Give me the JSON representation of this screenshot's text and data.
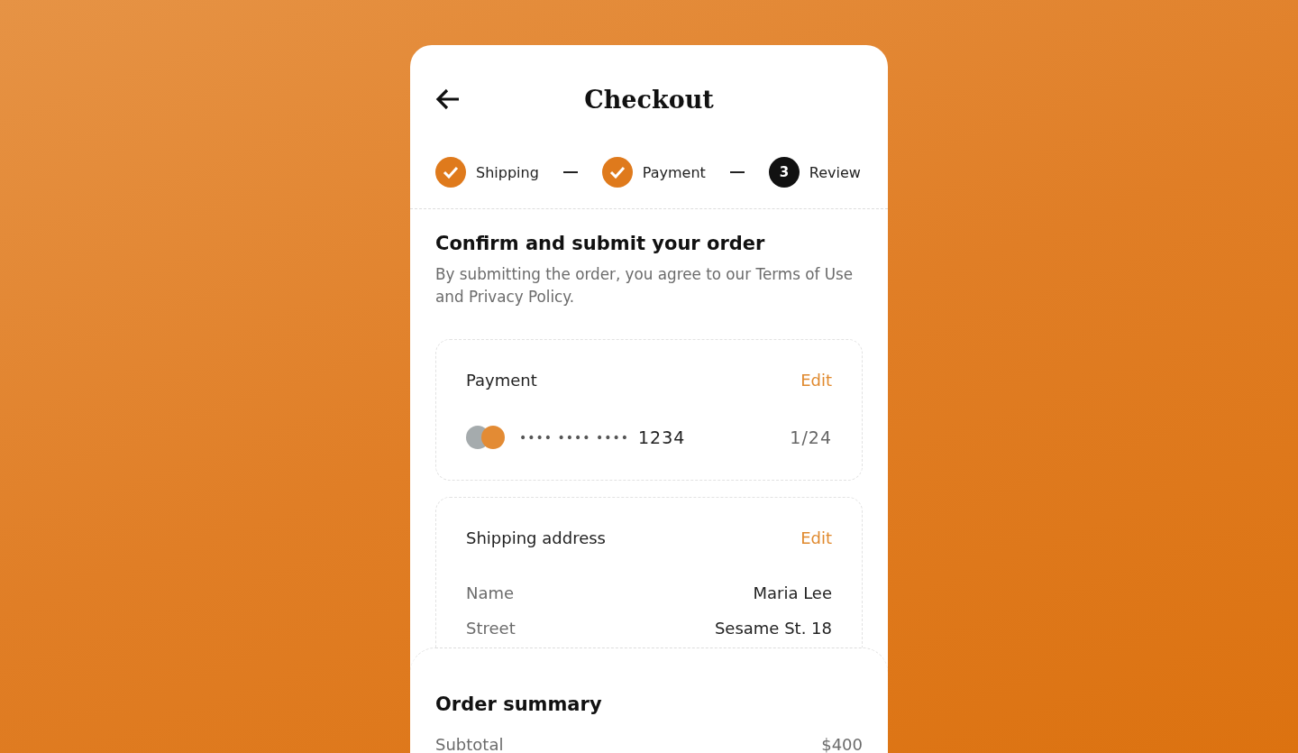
{
  "header": {
    "title": "Checkout"
  },
  "steps": [
    {
      "label": "Shipping",
      "done": true
    },
    {
      "label": "Payment",
      "done": true
    },
    {
      "label": "Review",
      "done": false,
      "number": "3"
    }
  ],
  "intro": {
    "heading": "Confirm and submit your order",
    "text": "By submitting the order, you agree to our Terms of Use and Privacy Policy."
  },
  "payment": {
    "title": "Payment",
    "edit": "Edit",
    "masked": "•••• •••• ••••",
    "last4": "1234",
    "expiry": "1/24"
  },
  "shipping": {
    "title": "Shipping address",
    "edit": "Edit",
    "rows": [
      {
        "label": "Name",
        "value": "Maria Lee"
      },
      {
        "label": "Street",
        "value": "Sesame St. 18"
      }
    ]
  },
  "summary": {
    "title": "Order summary",
    "rows": [
      {
        "label": "Subtotal",
        "value": "$400"
      }
    ]
  }
}
